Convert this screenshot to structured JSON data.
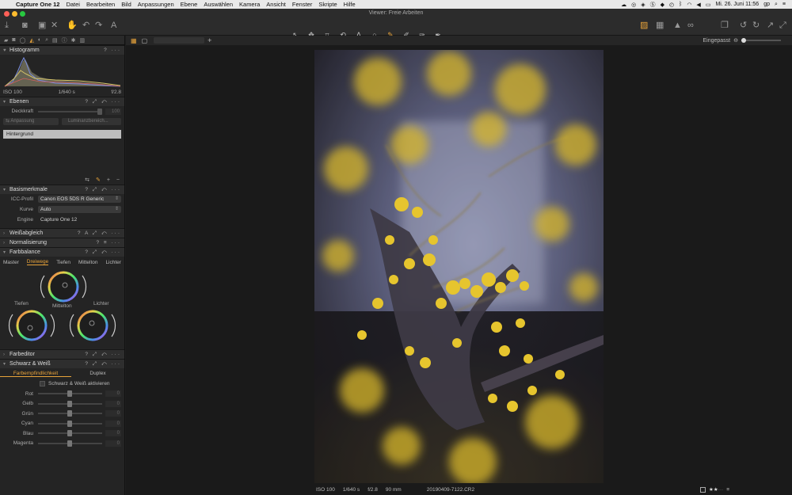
{
  "menubar": {
    "app_name": "Capture One 12",
    "items": [
      "Datei",
      "Bearbeiten",
      "Bild",
      "Anpassungen",
      "Ebene",
      "Auswählen",
      "Kamera",
      "Ansicht",
      "Fenster",
      "Skripte",
      "Hilfe"
    ],
    "clock": "Mi. 26. Juni  11:56",
    "user": "gp"
  },
  "window": {
    "title": "Viewer: Freie Arbeiten"
  },
  "histogram": {
    "title": "Histogramm",
    "iso": "ISO 100",
    "shutter": "1/640 s",
    "aperture": "f/2.8"
  },
  "layers": {
    "title": "Ebenen",
    "opacity_label": "Deckkraft",
    "opacity_value": "100",
    "adjust_label": "Anpassung",
    "luminance_label": "Luminanzbereich...",
    "background_layer": "Hintergrund"
  },
  "base": {
    "title": "Basismerkmale",
    "icc_label": "ICC-Profil",
    "icc_value": "Canon EOS 5DS R Generic",
    "curve_label": "Kurve",
    "curve_value": "Auto",
    "engine_label": "Engine",
    "engine_value": "Capture One 12"
  },
  "sections": {
    "white_balance": "Weißabgleich",
    "normalization": "Normalisierung",
    "color_balance": "Farbbalance",
    "color_editor": "Farbeditor",
    "bw": "Schwarz & Weiß"
  },
  "color_balance": {
    "tabs": [
      "Master",
      "Dreiwege",
      "Tiefen",
      "Mittelton",
      "Lichter"
    ],
    "active_tab": "Dreiwege",
    "wheel_mid": "Mittelton",
    "wheel_low": "Tiefen",
    "wheel_high": "Lichter"
  },
  "bw": {
    "tabs": [
      "Farbempfindlichkeit",
      "Duplex"
    ],
    "enable_label": "Schwarz & Weiß aktivieren",
    "channels": [
      "Rot",
      "Gelb",
      "Grün",
      "Cyan",
      "Blau",
      "Magenta"
    ],
    "channel_values": [
      "0",
      "0",
      "0",
      "0",
      "0",
      "0"
    ]
  },
  "viewer": {
    "zoom_label": "Eingepasst",
    "status_iso": "ISO 100",
    "status_shutter": "1/640 s",
    "status_aperture": "f/2.8",
    "status_focal": "90 mm",
    "filename": "20190409-7122.CR2",
    "rating": 2,
    "rating_max": 5
  },
  "colors": {
    "accent": "#e8a33a",
    "panel_bg": "#242424",
    "viewer_bg": "#1a1a1a"
  }
}
